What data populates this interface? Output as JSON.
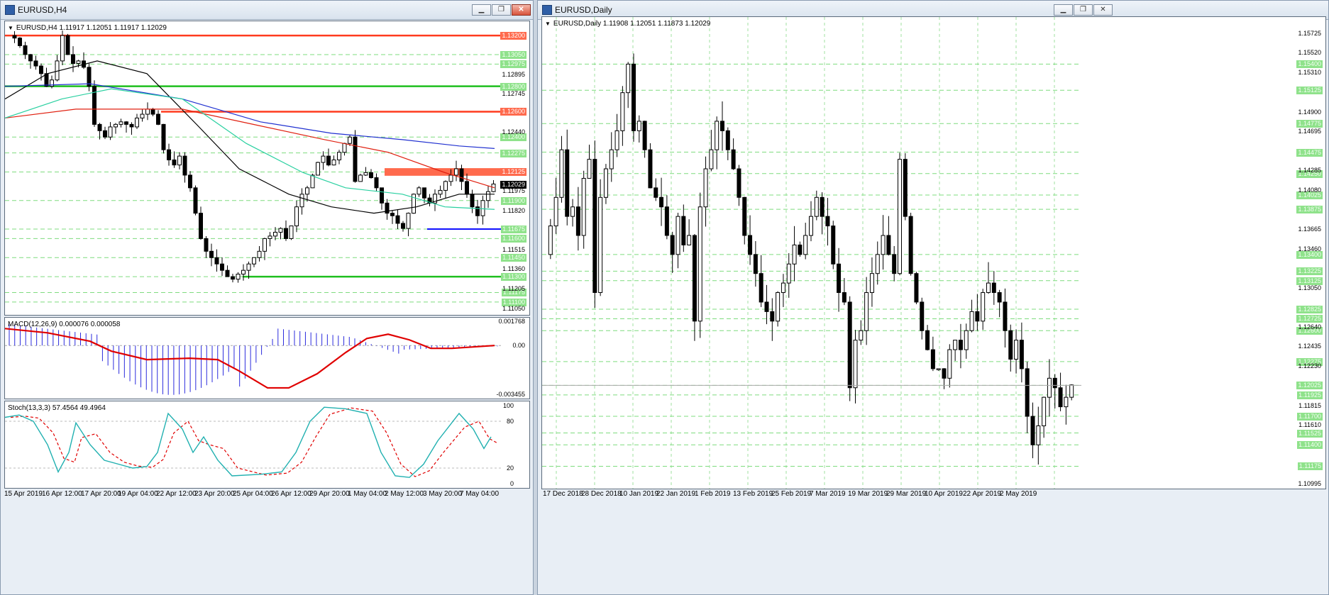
{
  "left_window": {
    "title": "EURUSD,H4",
    "buttons": [
      "minimize",
      "restore",
      "close"
    ],
    "ohlc_line": "EURUSD,H4  1.11917 1.12051 1.11917 1.12029",
    "macd_label": "MACD(12,26,9) 0.000076 0.000058",
    "stoch_label": "Stoch(13,3,3) 57.4564 49.4964",
    "price_labels": {
      "green": [
        "1.13200",
        "1.13050",
        "1.12975",
        "1.12800",
        "1.12400",
        "1.12275",
        "1.12125",
        "1.11900",
        "1.11675",
        "1.11600",
        "1.11450",
        "1.11300",
        "1.11175",
        "1.11100"
      ],
      "red": [
        "1.13200",
        "1.12600",
        "1.12125"
      ],
      "plain": [
        "1.12895",
        "1.12745",
        "1.12440",
        "1.11975",
        "1.11820",
        "1.11515",
        "1.11360",
        "1.11205",
        "1.11050"
      ],
      "current": "1.12029"
    },
    "macd_axis": [
      "0.001768",
      "0.00",
      "-0.003455"
    ],
    "stoch_axis": [
      "100",
      "80",
      "20",
      "0"
    ],
    "x_labels": [
      "15 Apr 2019",
      "16 Apr 12:00",
      "17 Apr 20:00",
      "19 Apr 04:00",
      "22 Apr 12:00",
      "23 Apr 20:00",
      "25 Apr 04:00",
      "26 Apr 12:00",
      "29 Apr 20:00",
      "1 May 04:00",
      "2 May 12:00",
      "3 May 20:00",
      "7 May 04:00"
    ]
  },
  "right_window": {
    "title": "EURUSD,Daily",
    "buttons": [
      "minimize",
      "restore",
      "close"
    ],
    "ohlc_line": "EURUSD,Daily  1.11908 1.12051 1.11873 1.12029",
    "price_labels": {
      "green": [
        "1.15400",
        "1.15125",
        "1.14775",
        "1.14475",
        "1.14250",
        "1.14025",
        "1.13875",
        "1.13400",
        "1.13225",
        "1.13125",
        "1.12825",
        "1.12725",
        "1.12600",
        "1.12275",
        "1.12025",
        "1.11925",
        "1.11700",
        "1.11525",
        "1.11400",
        "1.11175"
      ],
      "plain": [
        "1.15725",
        "1.15520",
        "1.15310",
        "1.14900",
        "1.14695",
        "1.14285",
        "1.14080",
        "1.13665",
        "1.13460",
        "1.13050",
        "1.12640",
        "1.12435",
        "1.12230",
        "1.11815",
        "1.11610",
        "1.10995"
      ]
    },
    "x_labels": [
      "17 Dec 2018",
      "28 Dec 2018",
      "10 Jan 2019",
      "22 Jan 2019",
      "1 Feb 2019",
      "13 Feb 2019",
      "25 Feb 2019",
      "7 Mar 2019",
      "19 Mar 2019",
      "29 Mar 2019",
      "10 Apr 2019",
      "22 Apr 2019",
      "2 May 2019"
    ]
  },
  "colors": {
    "green_level": "#1fbf1f",
    "red_level": "#ff3b1f",
    "blue_level": "#1010ff",
    "ma_black": "#000000",
    "ma_red": "#e02010",
    "ma_blue": "#2030d0",
    "ma_cyan": "#29d0a0",
    "macd_hist": "#2b2bdd",
    "macd_signal": "#e00000",
    "stoch_main": "#20b0b0",
    "stoch_signal": "#e00000"
  }
}
